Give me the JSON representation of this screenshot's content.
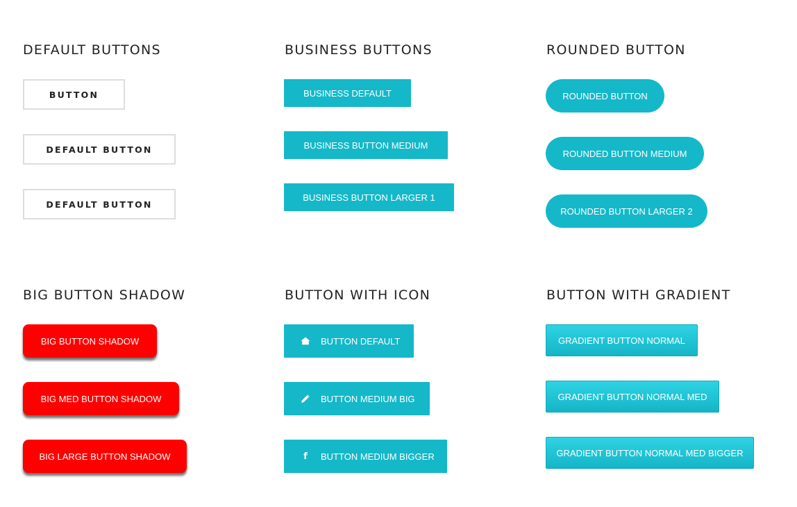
{
  "sections": {
    "default": {
      "title": "DEFAULT BUTTONS",
      "buttons": [
        "BUTTON",
        "DEFAULT BUTTON",
        "DEFAULT BUTTON"
      ]
    },
    "business": {
      "title": "BUSINESS BUTTONS",
      "buttons": [
        "BUSINESS DEFAULT",
        "BUSINESS BUTTON MEDIUM",
        "BUSINESS BUTTON LARGER  1"
      ]
    },
    "rounded": {
      "title": "ROUNDED BUTTON",
      "buttons": [
        "ROUNDED BUTTON",
        "ROUNDED BUTTON MEDIUM",
        "ROUNDED BUTTON LARGER 2"
      ]
    },
    "shadow": {
      "title": "BIG BUTTON SHADOW",
      "buttons": [
        "BIG BUTTON SHADOW",
        "BIG MED BUTTON SHADOW",
        "BIG LARGE BUTTON SHADOW"
      ]
    },
    "icon": {
      "title": "BUTTON WITH ICON",
      "buttons": [
        {
          "label": "BUTTON DEFAULT",
          "icon": "home-icon"
        },
        {
          "label": "BUTTON MEDIUM BIG",
          "icon": "pencil-icon"
        },
        {
          "label": "BUTTON MEDIUM BIGGER",
          "icon": "facebook-icon",
          "glyph": "f"
        }
      ]
    },
    "gradient": {
      "title": "BUTTON WITH GRADIENT",
      "buttons": [
        "GRADIENT BUTTON NORMAL",
        "GRADIENT BUTTON NORMAL MED",
        "GRADIENT BUTTON NORMAL MED BIGGER"
      ]
    }
  },
  "colors": {
    "teal": "#15b8c8",
    "red": "#ff0000",
    "border": "#dddddd",
    "title_text": "#222222"
  }
}
